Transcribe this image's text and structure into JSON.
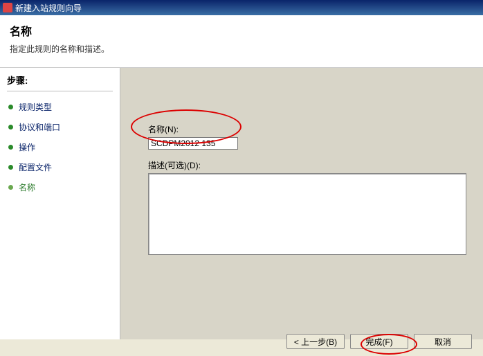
{
  "window": {
    "title": "新建入站规则向导"
  },
  "header": {
    "title": "名称",
    "subtitle": "指定此规则的名称和描述。"
  },
  "sidebar": {
    "steps_label": "步骤:",
    "items": [
      {
        "label": "规则类型"
      },
      {
        "label": "协议和端口"
      },
      {
        "label": "操作"
      },
      {
        "label": "配置文件"
      },
      {
        "label": "名称"
      }
    ]
  },
  "form": {
    "name_label": "名称(N):",
    "name_value": "SCDPM2012 135",
    "desc_label": "描述(可选)(D):",
    "desc_value": ""
  },
  "buttons": {
    "back": "< 上一步(B)",
    "finish": "完成(F)",
    "cancel": "取消"
  }
}
